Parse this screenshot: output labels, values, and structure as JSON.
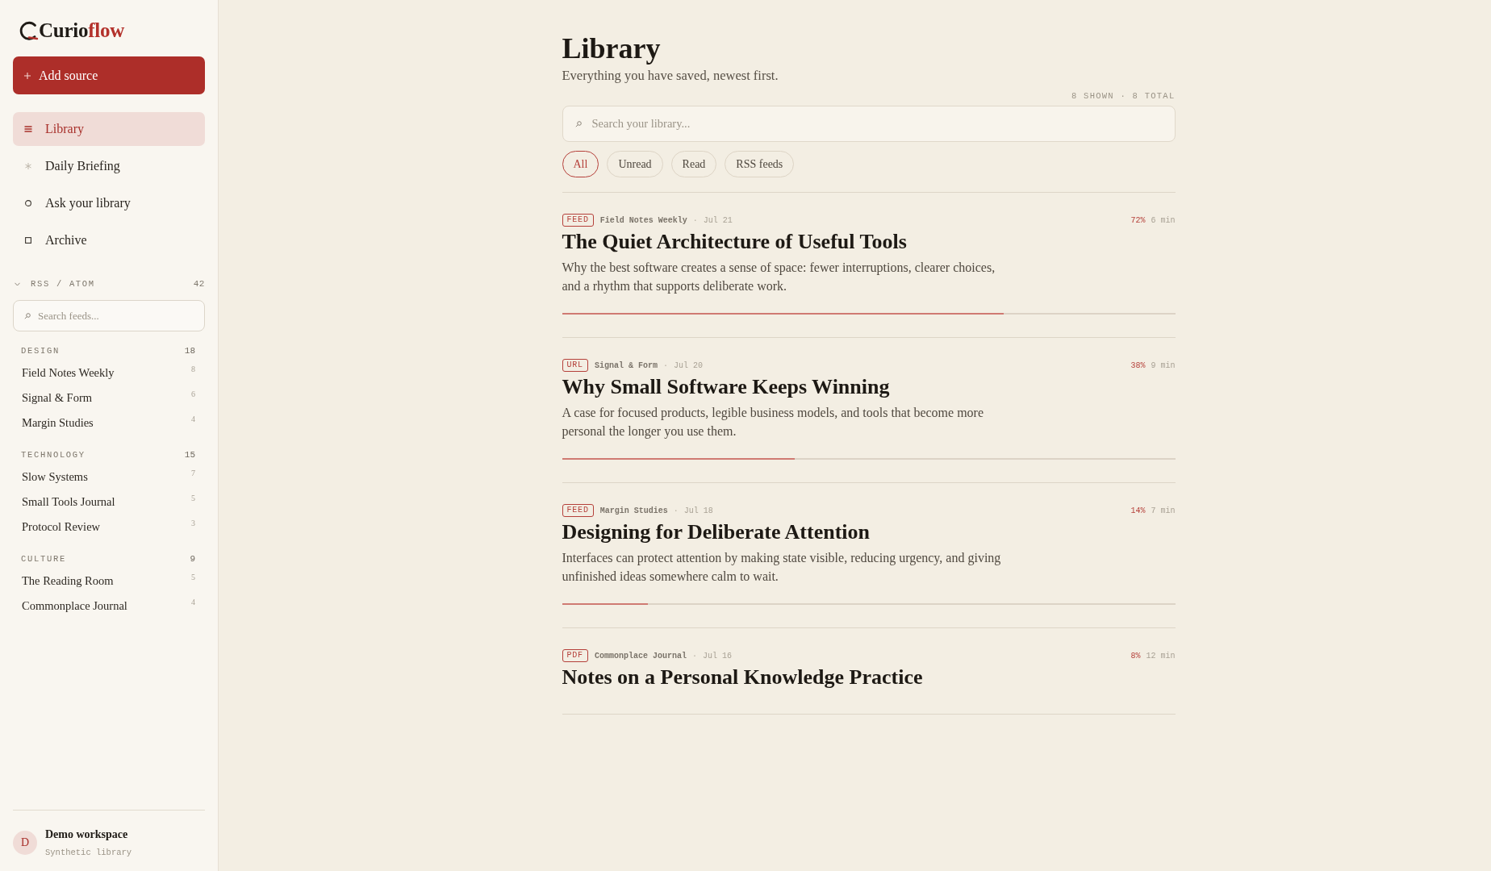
{
  "sidebar": {
    "logo": {
      "text": "Curio",
      "accent": "flow"
    },
    "add_button": {
      "label": "Add source"
    },
    "nav": [
      {
        "label": "Library",
        "selected": true
      },
      {
        "label": "Daily Briefing",
        "selected": false
      },
      {
        "label": "Ask your library",
        "selected": false
      },
      {
        "label": "Archive",
        "selected": false
      }
    ],
    "feeds": {
      "title": "RSS / ATOM",
      "count": "42",
      "expanded": true,
      "search": {
        "placeholder": "Search feeds..."
      },
      "groups": [
        {
          "name": "DESIGN",
          "count": "18",
          "children": [
            {
              "name": "Field Notes Weekly",
              "count": "8"
            },
            {
              "name": "Signal & Form",
              "count": "6"
            },
            {
              "name": "Margin Studies",
              "count": "4"
            }
          ]
        },
        {
          "name": "TECHNOLOGY",
          "count": "15",
          "children": [
            {
              "name": "Slow Systems",
              "count": "7"
            },
            {
              "name": "Small Tools Journal",
              "count": "5"
            },
            {
              "name": "Protocol Review",
              "count": "3"
            }
          ]
        },
        {
          "name": "CULTURE",
          "count": "9",
          "children": [
            {
              "name": "The Reading Room",
              "count": "5"
            },
            {
              "name": "Commonplace Journal",
              "count": "4"
            }
          ]
        }
      ]
    },
    "workspace": {
      "initial": "D",
      "name": "Demo workspace",
      "subtitle": "Synthetic library"
    }
  },
  "main": {
    "title": "Library",
    "subtitle": "Everything you have saved, newest first.",
    "result_count": "8 SHOWN · 8 TOTAL",
    "search": {
      "placeholder": "Search your library..."
    },
    "filters": [
      {
        "label": "All",
        "selected": true
      },
      {
        "label": "Unread",
        "selected": false
      },
      {
        "label": "Read",
        "selected": false
      },
      {
        "label": "RSS feeds",
        "selected": false
      }
    ],
    "articles": [
      {
        "type": "FEED",
        "source": "Field Notes Weekly",
        "separator": "·",
        "date": "Jul 21",
        "progress": "72%",
        "read_time": "6 min",
        "title": "The Quiet Architecture of Useful Tools",
        "summary": "Why the best software creates a sense of space: fewer interruptions, clearer choices, and a rhythm that supports deliberate work.",
        "level": 0.72
      },
      {
        "type": "URL",
        "source": "Signal & Form",
        "separator": "·",
        "date": "Jul 20",
        "progress": "38%",
        "read_time": "9 min",
        "title": "Why Small Software Keeps Winning",
        "summary": "A case for focused products, legible business models, and tools that become more personal the longer you use them.",
        "level": 0.38
      },
      {
        "type": "FEED",
        "source": "Margin Studies",
        "separator": "·",
        "date": "Jul 18",
        "progress": "14%",
        "read_time": "7 min",
        "title": "Designing for Deliberate Attention",
        "summary": "Interfaces can protect attention by making state visible, reducing urgency, and giving unfinished ideas somewhere calm to wait.",
        "level": 0.14
      },
      {
        "type": "PDF",
        "source": "Commonplace Journal",
        "separator": "·",
        "date": "Jul 16",
        "progress": "8%",
        "read_time": "12 min",
        "title": "Notes on a Personal Knowledge Practice"
      }
    ]
  }
}
